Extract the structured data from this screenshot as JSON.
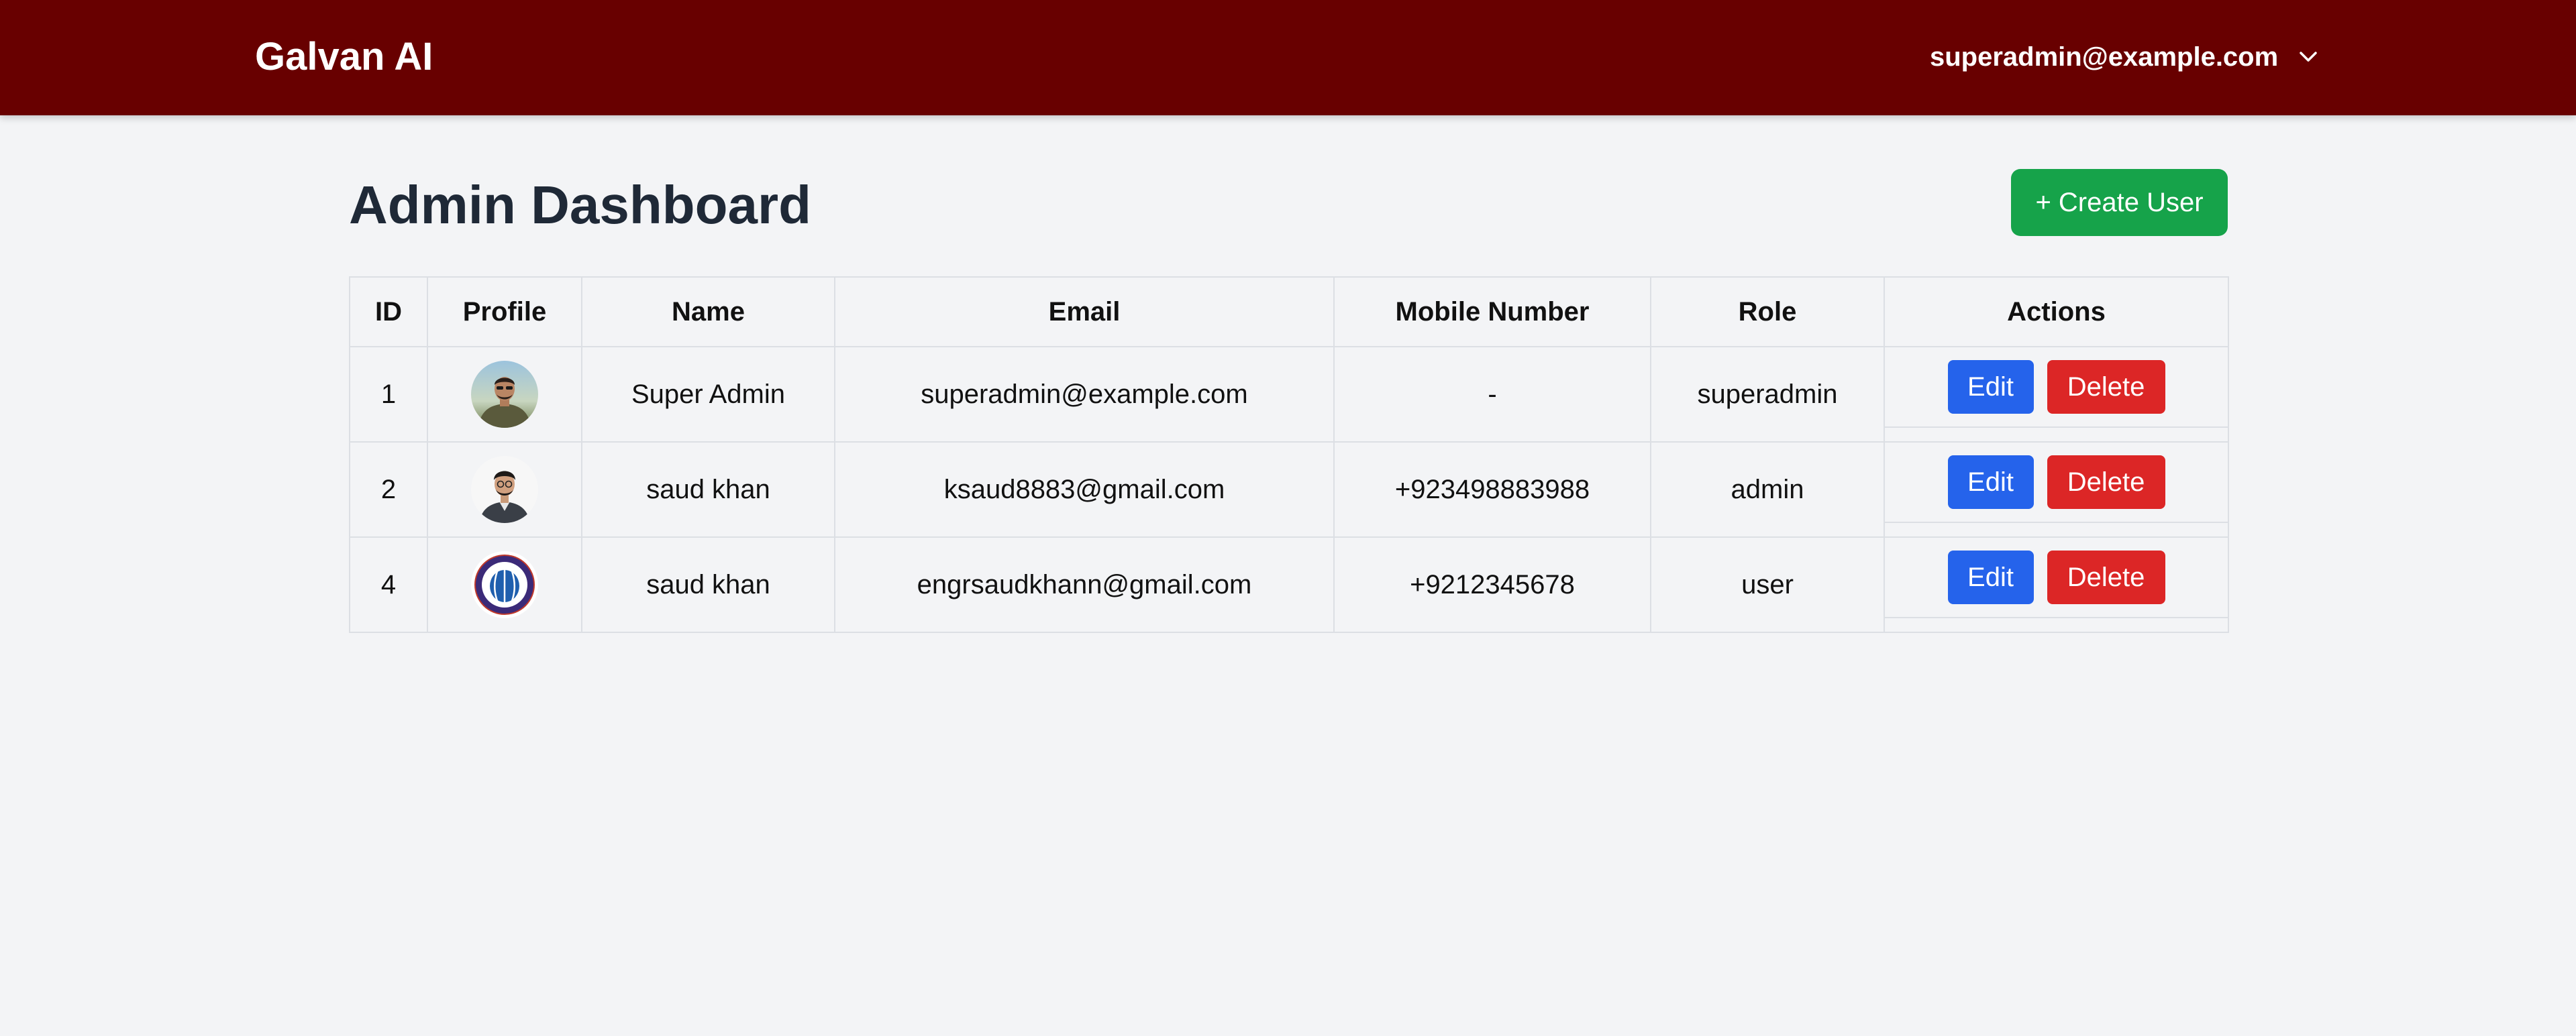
{
  "navbar": {
    "brand": "Galvan AI",
    "user_email": "superadmin@example.com",
    "dropdown_icon": "chevron-down-icon"
  },
  "page": {
    "title": "Admin Dashboard",
    "create_button_label": "+ Create User"
  },
  "table": {
    "headers": [
      "ID",
      "Profile",
      "Name",
      "Email",
      "Mobile Number",
      "Role",
      "Actions"
    ],
    "rows": [
      {
        "id": "1",
        "name": "Super Admin",
        "email": "superadmin@example.com",
        "mobile": "-",
        "role": "superadmin",
        "avatar": "avatar-photo-outdoor"
      },
      {
        "id": "2",
        "name": "saud khan",
        "email": "ksaud8883@gmail.com",
        "mobile": "+923498883988",
        "role": "admin",
        "avatar": "avatar-photo-portrait"
      },
      {
        "id": "4",
        "name": "saud khan",
        "email": "engrsaudkhann@gmail.com",
        "mobile": "+9212345678",
        "role": "user",
        "avatar": "avatar-university-logo"
      }
    ],
    "edit_label": "Edit",
    "delete_label": "Delete"
  },
  "colors": {
    "navbar": "#680000",
    "create_button": "#16a34a",
    "edit_button": "#2563eb",
    "delete_button": "#dc2626",
    "background": "#f3f4f6"
  }
}
